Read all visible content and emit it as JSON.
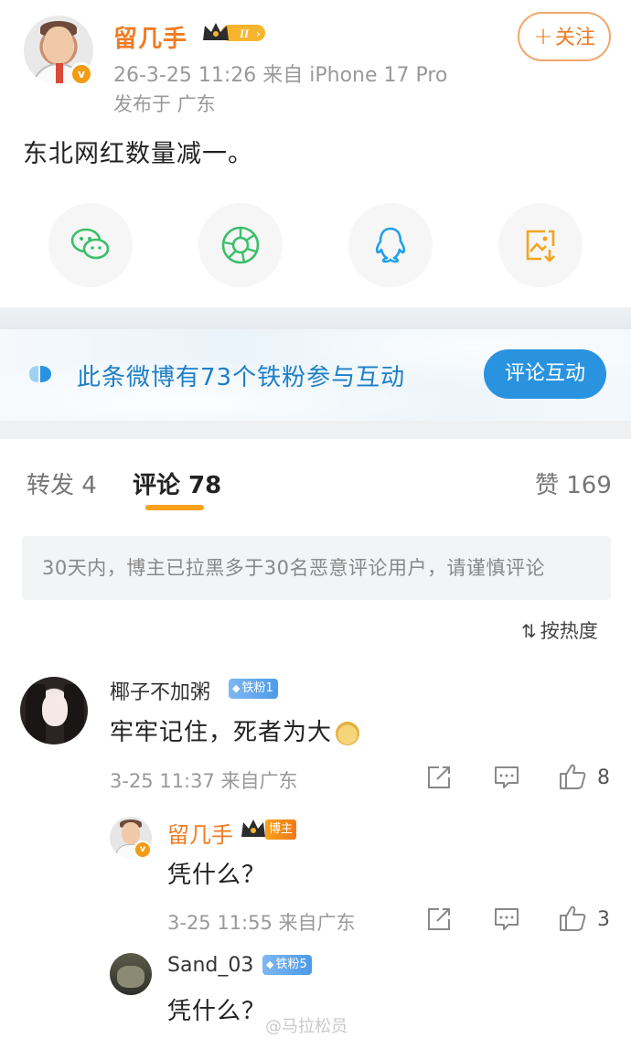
{
  "post": {
    "author": "留几手",
    "level_badge": "II",
    "time_source": "26-3-25 11:26  来自 iPhone 17 Pro",
    "location": "发布于 广东",
    "follow_label": "关注",
    "content": "东北网红数量减一。",
    "share_icons": [
      "wechat-icon",
      "moments-icon",
      "qq-icon",
      "save-image-icon"
    ]
  },
  "fans_banner": {
    "text": "此条微博有73个铁粉参与互动",
    "button": "评论互动"
  },
  "tabs": {
    "repost": "转发 4",
    "comments": "评论 78",
    "likes": "赞 169"
  },
  "notice": "30天内，博主已拉黑多于30名恶意评论用户，请谨慎评论",
  "sort_label": "按热度",
  "comments": [
    {
      "user": "椰子不加粥",
      "badge": "铁粉1",
      "text": "牢牢记住，死者为大",
      "meta": "3-25 11:37  来自广东",
      "likes": "8",
      "replies": [
        {
          "user": "留几手",
          "badge": "博主",
          "text": "凭什么？",
          "meta": "3-25 11:55  来自广东",
          "likes": "3"
        },
        {
          "user": "Sand_03",
          "badge": "铁粉5",
          "text": "凭什么？"
        }
      ]
    }
  ],
  "watermark": "@马拉松员",
  "colors": {
    "accent_orange": "#f07c24",
    "link_blue": "#1d7fc7",
    "button_blue": "#2a93e0",
    "tab_underline": "#f7a21b"
  }
}
